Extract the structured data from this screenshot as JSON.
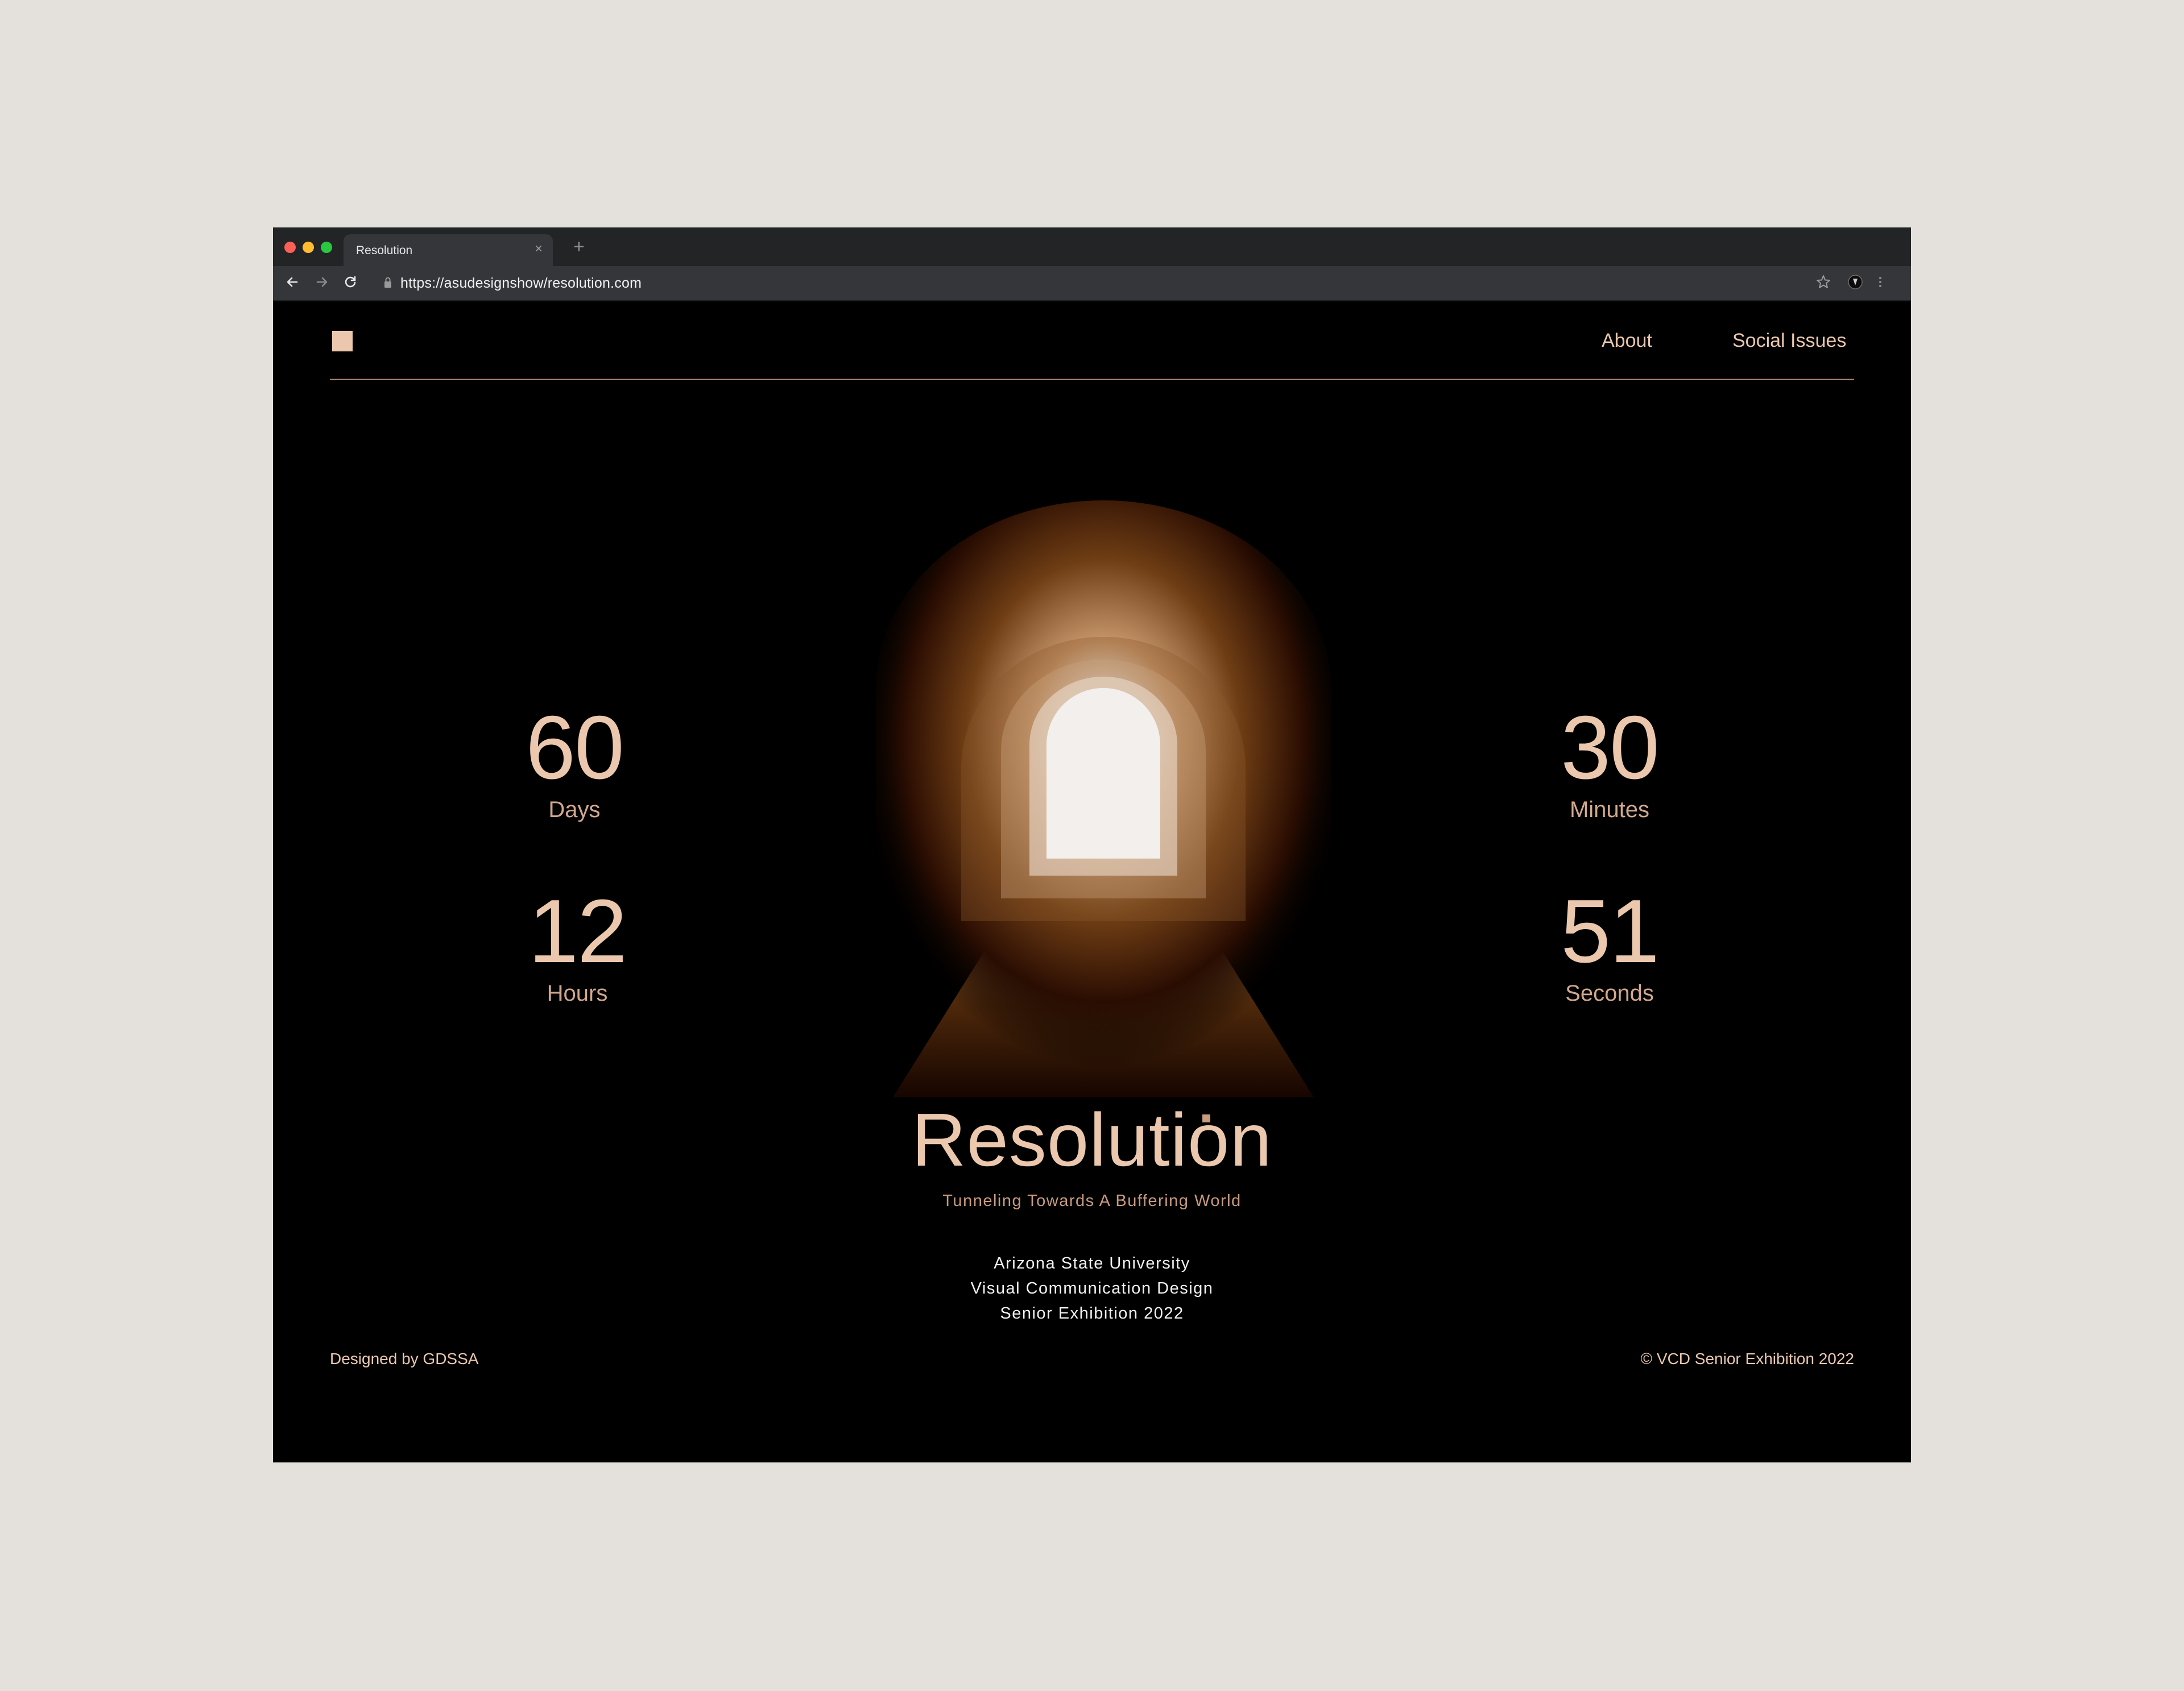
{
  "browser": {
    "tab_title": "Resolution",
    "tab_close": "×",
    "new_tab": "+",
    "url": "https://asudesignshow/resolution.com"
  },
  "nav": {
    "about": "About",
    "social_issues": "Social Issues"
  },
  "countdown": {
    "days": {
      "value": "60",
      "label": "Days"
    },
    "hours": {
      "value": "12",
      "label": "Hours"
    },
    "minutes": {
      "value": "30",
      "label": "Minutes"
    },
    "seconds": {
      "value": "51",
      "label": "Seconds"
    }
  },
  "hero": {
    "title": "Resolution",
    "subtitle": "Tunneling Towards A Buffering World"
  },
  "info": {
    "line1": "Arizona State University",
    "line2": "Visual Communication Design",
    "line3": "Senior Exhibition 2022"
  },
  "footer": {
    "left": "Designed by GDSSA",
    "right": "© VCD Senior Exhibition 2022"
  },
  "colors": {
    "accent": "#ebc7ad",
    "background": "#000000",
    "page_backdrop": "#e4e0dc"
  }
}
